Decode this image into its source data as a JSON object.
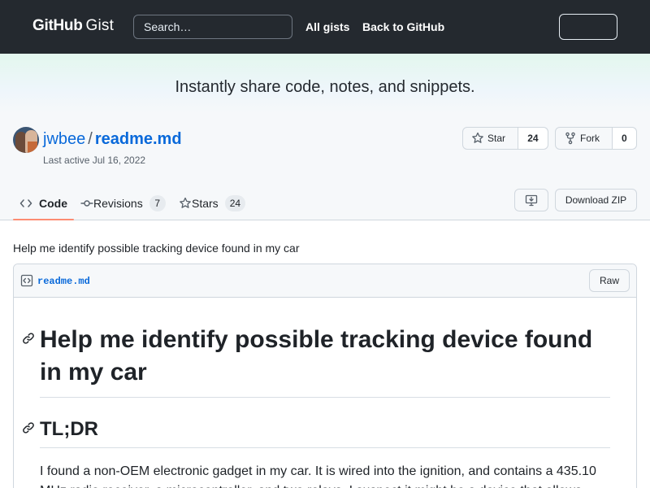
{
  "header": {
    "logo_bold": "GitHub",
    "logo_light": "Gist",
    "search_placeholder": "Search…",
    "all_gists": "All gists",
    "back_to_github": "Back to GitHub"
  },
  "banner": {
    "tagline": "Instantly share code, notes, and snippets."
  },
  "gist": {
    "owner": "jwbee",
    "separator": "/",
    "filename": "readme.md",
    "last_active": "Last active Jul 16, 2022",
    "star_label": "Star",
    "star_count": "24",
    "fork_label": "Fork",
    "fork_count": "0"
  },
  "tabs": [
    {
      "label": "Code",
      "selected": true
    },
    {
      "label": "Revisions",
      "count": "7"
    },
    {
      "label": "Stars",
      "count": "24"
    }
  ],
  "actions": {
    "download_zip": "Download ZIP"
  },
  "description": "Help me identify possible tracking device found in my car",
  "file": {
    "name": "readme.md",
    "raw_label": "Raw"
  },
  "content": {
    "h1": "Help me identify possible tracking device found in my car",
    "h2": "TL;DR",
    "paragraph": "I found a non-OEM electronic gadget in my car. It is wired into the ignition, and contains a 435.10 MHz radio receiver, a microcontroller, and two relays. I suspect it might be a device that allows"
  },
  "colors": {
    "header_bg": "#24292f",
    "link": "#0969da",
    "tab_underline": "#fd8c73",
    "border": "#d0d7de"
  }
}
